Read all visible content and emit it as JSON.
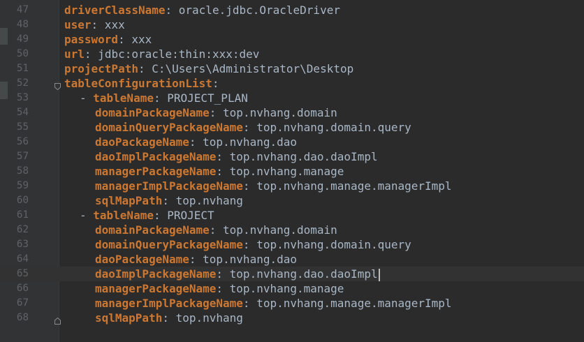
{
  "lines": [
    {
      "num": "47",
      "indent": 0,
      "dash": false,
      "key": "driverClassName",
      "val": "oracle.jdbc.OracleDriver"
    },
    {
      "num": "48",
      "indent": 0,
      "dash": false,
      "key": "user",
      "val": "xxx"
    },
    {
      "num": "49",
      "indent": 0,
      "dash": false,
      "key": "password",
      "val": "xxx"
    },
    {
      "num": "50",
      "indent": 0,
      "dash": false,
      "key": "url",
      "val": "jdbc:oracle:thin:xxx:dev"
    },
    {
      "num": "51",
      "indent": 0,
      "dash": false,
      "key": "projectPath",
      "val": "C:\\Users\\Administrator\\Desktop"
    },
    {
      "num": "52",
      "indent": 0,
      "dash": false,
      "key": "tableConfigurationList",
      "val": "",
      "fold": "open"
    },
    {
      "num": "53",
      "indent": 1,
      "dash": true,
      "key": "tableName",
      "val": "PROJECT_PLAN"
    },
    {
      "num": "54",
      "indent": 2,
      "dash": false,
      "key": "domainPackageName",
      "val": "top.nvhang.domain"
    },
    {
      "num": "55",
      "indent": 2,
      "dash": false,
      "key": "domainQueryPackageName",
      "val": "top.nvhang.domain.query"
    },
    {
      "num": "56",
      "indent": 2,
      "dash": false,
      "key": "daoPackageName",
      "val": "top.nvhang.dao"
    },
    {
      "num": "57",
      "indent": 2,
      "dash": false,
      "key": "daoImplPackageName",
      "val": "top.nvhang.dao.daoImpl"
    },
    {
      "num": "58",
      "indent": 2,
      "dash": false,
      "key": "managerPackageName",
      "val": "top.nvhang.manage"
    },
    {
      "num": "59",
      "indent": 2,
      "dash": false,
      "key": "managerImplPackageName",
      "val": "top.nvhang.manage.managerImpl"
    },
    {
      "num": "60",
      "indent": 2,
      "dash": false,
      "key": "sqlMapPath",
      "val": "top.nvhang"
    },
    {
      "num": "61",
      "indent": 1,
      "dash": true,
      "key": "tableName",
      "val": "PROJECT"
    },
    {
      "num": "62",
      "indent": 2,
      "dash": false,
      "key": "domainPackageName",
      "val": "top.nvhang.domain"
    },
    {
      "num": "63",
      "indent": 2,
      "dash": false,
      "key": "domainQueryPackageName",
      "val": "top.nvhang.domain.query"
    },
    {
      "num": "64",
      "indent": 2,
      "dash": false,
      "key": "daoPackageName",
      "val": "top.nvhang.dao"
    },
    {
      "num": "65",
      "indent": 2,
      "dash": false,
      "key": "daoImplPackageName",
      "val": "top.nvhang.dao.daoImpl",
      "current": true
    },
    {
      "num": "66",
      "indent": 2,
      "dash": false,
      "key": "managerPackageName",
      "val": "top.nvhang.manage"
    },
    {
      "num": "67",
      "indent": 2,
      "dash": false,
      "key": "managerImplPackageName",
      "val": "top.nvhang.manage.managerImpl"
    },
    {
      "num": "68",
      "indent": 2,
      "dash": false,
      "key": "sqlMapPath",
      "val": "top.nvhang",
      "fold": "close"
    }
  ],
  "colors": {
    "background": "#2b2b2b",
    "gutter": "#313335",
    "key": "#cc7832",
    "value": "#a9b7c6",
    "line_number": "#606366",
    "current_line": "#323232"
  },
  "icons": {
    "fold_open": "fold-open-icon",
    "fold_close": "fold-close-icon"
  }
}
